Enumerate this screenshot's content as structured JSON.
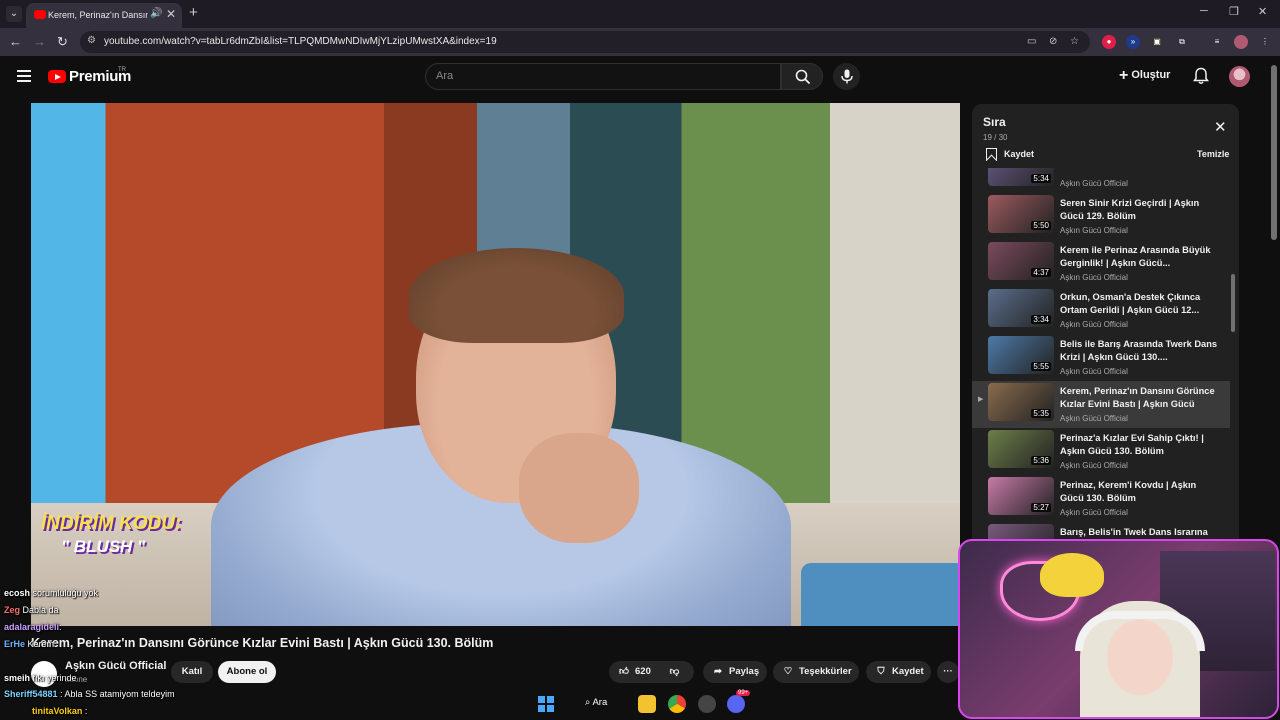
{
  "browser": {
    "tab_title": "Kerem, Perinaz'ın Dansını Görünce Kızlar Evini Bastı | Aşkın Gücü 130. Bölüm",
    "url": "youtube.com/watch?v=tabLr6dmZbI&list=TLPQMDMwNDIwMjYLzipUMwstXA&index=19"
  },
  "yt": {
    "brand": "Premium",
    "region": "TR",
    "search_placeholder": "Ara",
    "create_label": "Oluştur"
  },
  "video": {
    "promo_line1": "İNDİRİM KODU:",
    "promo_line2": "\" BLUSH \"",
    "title": "Kerem, Perinaz'ın Dansını Görünce Kızlar Evini Bastı | Aşkın Gücü 130. Bölüm",
    "channel": "Aşkın Gücü Official",
    "subs": "abone",
    "join_label": "Katıl",
    "subscribe_label": "Abone ol",
    "likes": "620",
    "share_label": "Paylaş",
    "thanks_label": "Teşekkürler",
    "save_label": "Kaydet",
    "more_label": "···"
  },
  "queue": {
    "title": "Sıra",
    "position": "19 / 30",
    "save_label": "Kaydet",
    "clear_label": "Temizle",
    "items": [
      {
        "title": "",
        "duration": "5:34",
        "channel": "Aşkın Gücü Official",
        "thumb": "#6a5c8a"
      },
      {
        "title": "Seren Sinir Krizi Geçirdi | Aşkın Gücü 129. Bölüm",
        "duration": "5:50",
        "channel": "Aşkın Gücü Official",
        "thumb": "#9c5a5f"
      },
      {
        "title": "Kerem ile Perinaz Arasında Büyük Gerginlik! | Aşkın Gücü...",
        "duration": "4:37",
        "channel": "Aşkın Gücü Official",
        "thumb": "#7b4a5c"
      },
      {
        "title": "Orkun, Osman'a Destek Çıkınca Ortam Gerildi | Aşkın Gücü 12...",
        "duration": "3:34",
        "channel": "Aşkın Gücü Official",
        "thumb": "#5a6e8c"
      },
      {
        "title": "Belis ile Barış Arasında Twerk Dans Krizi | Aşkın Gücü 130....",
        "duration": "5:55",
        "channel": "Aşkın Gücü Official",
        "thumb": "#4d7aa8"
      },
      {
        "title": "Kerem, Perinaz'ın Dansını Görünce Kızlar Evini Bastı | Aşkın Gücü 130....",
        "duration": "5:35",
        "channel": "Aşkın Gücü Official",
        "thumb": "#8a6b4e",
        "active": true
      },
      {
        "title": "Perinaz'a Kızlar Evi Sahip Çıktı! | Aşkın Gücü 130. Bölüm",
        "duration": "5:36",
        "channel": "Aşkın Gücü Official",
        "thumb": "#6d7f4a"
      },
      {
        "title": "Perinaz, Kerem'i Kovdu | Aşkın Gücü 130. Bölüm",
        "duration": "5:27",
        "channel": "Aşkın Gücü Official",
        "thumb": "#c87aa8"
      },
      {
        "title": "Barış, Belis'in Twek Dans Israrına Çıldırdı! | Aşkın Gücü...",
        "duration": "",
        "channel": "",
        "thumb": "#7a5a7e"
      }
    ]
  },
  "chat": [
    {
      "user": "ecosh",
      "text": " sorumluluğu yok",
      "color": "#ffffff"
    },
    {
      "user": "Zeg",
      "text": "Dabla da",
      "color": "#ff6b6b"
    },
    {
      "user": "adalaragideli",
      "text": ":",
      "color": "#c9a0ff"
    },
    {
      "user": "ErHe",
      "text": "Kerem",
      "color": "#6fb2ff"
    },
    {
      "user": "",
      "text": "",
      "color": "#ffffff"
    },
    {
      "user": "smeih",
      "text": "fıkı yerinde",
      "color": "#ffffff"
    },
    {
      "user": "Sheriff54881",
      "text": ": Abla SS atamiyom teldeyim",
      "color": "#7dd3fc"
    },
    {
      "user": "tinitaVolkan",
      "text": ":",
      "color": "#facc15"
    }
  ],
  "taskbar": {
    "search_label": "Ara",
    "badge": "99+"
  }
}
